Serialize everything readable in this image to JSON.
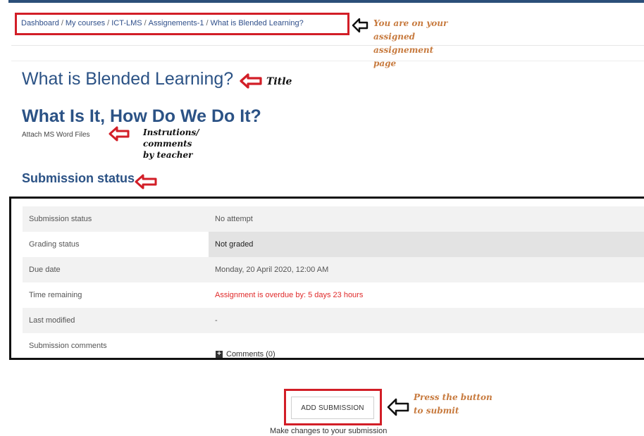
{
  "breadcrumb": {
    "items": [
      "Dashboard",
      "My courses",
      "ICT-LMS",
      "Assignements-1",
      "What is Blended Learning?"
    ],
    "separator": "/"
  },
  "assignment": {
    "title": "What is Blended Learning?",
    "subtitle": "What Is It, How Do We Do It?",
    "instructions": "Attach MS Word Files"
  },
  "submission": {
    "heading": "Submission status",
    "rows": [
      {
        "label": "Submission status",
        "value": "No attempt"
      },
      {
        "label": "Grading status",
        "value": "Not graded"
      },
      {
        "label": "Due date",
        "value": "Monday, 20 April 2020, 12:00 AM"
      },
      {
        "label": "Time remaining",
        "value": "Assignment is overdue by: 5 days 23 hours"
      },
      {
        "label": "Last modified",
        "value": "-"
      },
      {
        "label": "Submission comments",
        "value": ""
      }
    ],
    "comments_link": "Comments (0)"
  },
  "actions": {
    "add_submission_label": "ADD SUBMISSION",
    "add_submission_help": "Make changes to your submission"
  },
  "annotations": {
    "breadcrumb_note": [
      "You are on your",
      "assigned",
      "assignement",
      "page"
    ],
    "title_note": "Title",
    "instructions_note": [
      "Instrutions/",
      "comments",
      "by teacher"
    ],
    "button_note": [
      "Press the button",
      "to submit"
    ]
  },
  "colors": {
    "heading": "#2b5285",
    "annotation_box": "#d21e27",
    "overdue": "#e02a2a",
    "annotation_text": "#c77a3e"
  }
}
